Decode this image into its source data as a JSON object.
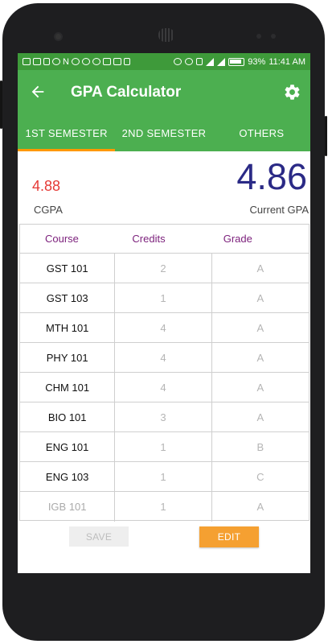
{
  "statusbar": {
    "battery": "93%",
    "time": "11:41 AM",
    "notification_letter": "N"
  },
  "appbar": {
    "title": "GPA Calculator",
    "back_icon": "arrow-back-icon",
    "settings_icon": "gear-icon"
  },
  "tabs": [
    {
      "label": "1ST SEMESTER",
      "active": true
    },
    {
      "label": "2ND SEMESTER",
      "active": false
    },
    {
      "label": "OTHERS",
      "active": false
    }
  ],
  "summary": {
    "cgpa_value": "4.88",
    "cgpa_label": "CGPA",
    "current_value": "4.86",
    "current_label": "Current GPA"
  },
  "table": {
    "headers": {
      "course": "Course",
      "credits": "Credits",
      "grade": "Grade"
    },
    "rows": [
      {
        "course": "GST 101",
        "credits": "2",
        "grade": "A"
      },
      {
        "course": "GST 103",
        "credits": "1",
        "grade": "A"
      },
      {
        "course": "MTH 101",
        "credits": "4",
        "grade": "A"
      },
      {
        "course": "PHY 101",
        "credits": "4",
        "grade": "A"
      },
      {
        "course": "CHM 101",
        "credits": "4",
        "grade": "A"
      },
      {
        "course": "BIO 101",
        "credits": "3",
        "grade": "A"
      },
      {
        "course": "ENG 101",
        "credits": "1",
        "grade": "B"
      },
      {
        "course": "ENG 103",
        "credits": "1",
        "grade": "C"
      },
      {
        "course": "IGB 101",
        "credits": "1",
        "grade": "A"
      }
    ]
  },
  "actions": {
    "save_label": "SAVE",
    "edit_label": "EDIT"
  },
  "colors": {
    "primary": "#4caf50",
    "status_bar": "#3e9a3a",
    "accent": "#ff9800",
    "cgpa": "#e53935",
    "current_gpa": "#2b2a86",
    "header_text": "#7b1f7b",
    "edit_button": "#f5a031"
  }
}
